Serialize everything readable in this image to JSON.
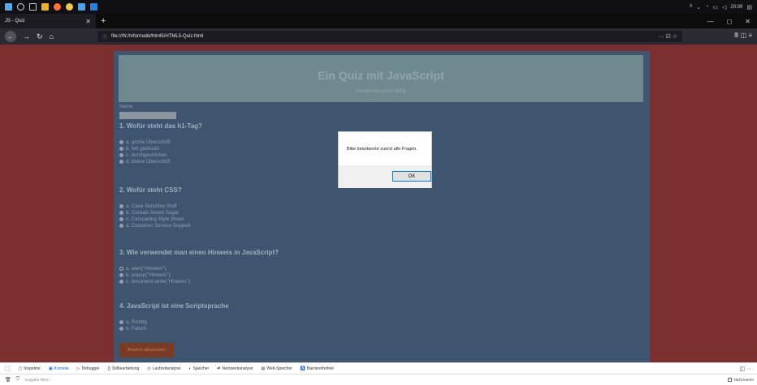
{
  "taskbar": {
    "time": "20:09",
    "icons": [
      "windows-icon",
      "search-icon",
      "task-view-icon",
      "explorer-icon",
      "firefox-icon",
      "chrome-icon",
      "store-icon",
      "app-icon"
    ],
    "colors": [
      "#5aa9e6",
      "#dddddd",
      "#cccccc",
      "#e8b32a",
      "#ff7139",
      "#f2c94c",
      "#4ea4e6",
      "#2e7dd7"
    ]
  },
  "browser": {
    "tab_title": "JS - Quiz",
    "url": "file:///N:/Informatik/html5/HTML5-Quiz.html",
    "url_actions": "··· ☑ ☆",
    "nav_right": "Ⅲ ◫ ≡"
  },
  "page": {
    "title": "Ein Quiz mit JavaScript",
    "subtitle": "Reisekosten.com WEB",
    "name_label": "Name:",
    "questions": [
      {
        "title": "1. Wofür steht das h1-Tag?",
        "options": [
          "a. große Überschrift",
          "b. fett gedruckt",
          "c. durchgestrichen",
          "d. kleine Überschrift"
        ]
      },
      {
        "title": "2. Wofür steht CSS?",
        "options": [
          "a. Case Sensitive Stuff",
          "b. Cereals Sweet Sugar",
          "c. Carscading Style Sheet",
          "d. Customer Service Support"
        ]
      },
      {
        "title": "3. Wie verwendet man einen Hinweis in JavaScript?",
        "options": [
          "a. alert(\"Hinweis\");",
          "b. popup(\"Hinweis\");",
          "c. document.write(\"Hinweis\");"
        ]
      },
      {
        "title": "4. JavaScript ist eine Scriptsprache",
        "options": [
          "a. Richtig",
          "b. Falsch"
        ]
      }
    ],
    "submit_label": "Antwort abschicken"
  },
  "dialog": {
    "message": "Bitte beantworte zuerst alle Fragen.",
    "ok_label": "OK"
  },
  "devtools": {
    "tabs": [
      {
        "icon": "▢",
        "label": "Inspektor"
      },
      {
        "icon": "▣",
        "label": "Konsole",
        "active": true
      },
      {
        "icon": "▷",
        "label": "Debugger"
      },
      {
        "icon": "{}",
        "label": "Stilbearbeitung"
      },
      {
        "icon": "◷",
        "label": "Laufzeitanalyse"
      },
      {
        "icon": "◐",
        "label": "Speicher"
      },
      {
        "icon": "⇄",
        "label": "Netzwerkanalyse"
      },
      {
        "icon": "▤",
        "label": "Web-Speicher"
      },
      {
        "icon": "♿",
        "label": "Barrierefreiheit"
      }
    ],
    "filter_placeholder": "Ausgabe filtern",
    "persist_label": "Nicht leeren"
  }
}
